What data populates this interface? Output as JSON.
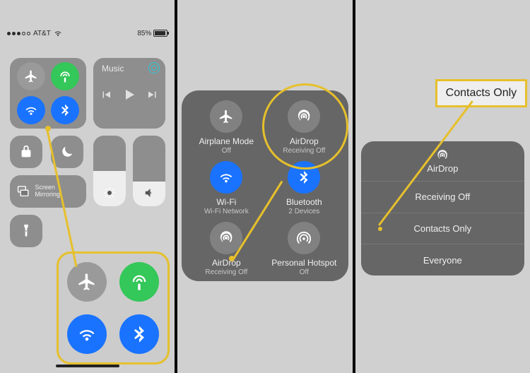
{
  "status": {
    "carrier": "AT&T",
    "battery_pct": "85%"
  },
  "panel1": {
    "music_label": "Music",
    "mirror_label": "Screen Mirroring"
  },
  "panel2": {
    "airplane": {
      "label": "Airplane Mode",
      "sub": "Off"
    },
    "airdrop": {
      "label": "AirDrop",
      "sub": "Receiving Off"
    },
    "wifi": {
      "label": "Wi-Fi",
      "sub": "Wi-Fi Network"
    },
    "bluetooth": {
      "label": "Bluetooth",
      "sub": "2 Devices"
    },
    "airdrop2": {
      "label": "AirDrop",
      "sub": "Receiving Off"
    },
    "hotspot": {
      "label": "Personal Hotspot",
      "sub": "Off"
    }
  },
  "panel3": {
    "callout": "Contacts Only",
    "menu_title": "AirDrop",
    "options": {
      "a": "Receiving Off",
      "b": "Contacts Only",
      "c": "Everyone"
    }
  }
}
